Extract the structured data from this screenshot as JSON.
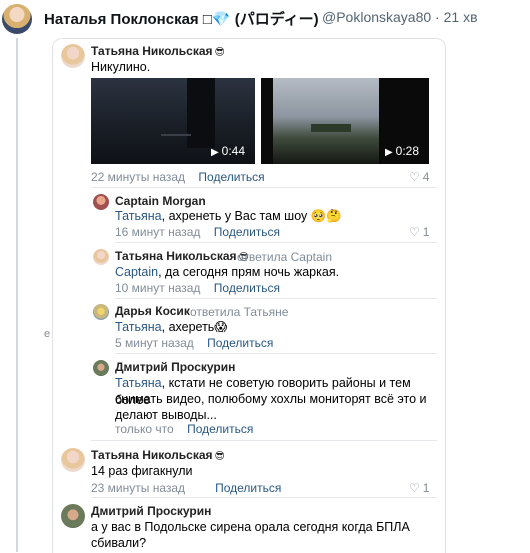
{
  "tweet": {
    "display_name": "Наталья Поклонская □💎 (パロディー)",
    "handle_time": "@Poklonskaya80 · 21 хв",
    "stray_char": "e"
  },
  "comments": [
    {
      "author": "Татьяна Никольская",
      "emoji": "😎",
      "text": "Никулино.",
      "videos": [
        {
          "duration": "0:44"
        },
        {
          "duration": "0:28"
        }
      ],
      "time": "22 минуты назад",
      "share": "Поделиться",
      "likes": "4"
    },
    {
      "author": "Captain Morgan",
      "mention": "Татьяна",
      "text": ", ахренеть у Вас там шоу 🥺🤔",
      "time": "16 минут назад",
      "share": "Поделиться",
      "likes": "1"
    },
    {
      "author": "Татьяна Никольская",
      "emoji": "😎",
      "reply_to": "ответила Captain",
      "mention": "Captain",
      "text": ", да сегодня прям ночь жаркая.",
      "time": "10 минут назад",
      "share": "Поделиться"
    },
    {
      "author": "Дарья Косик",
      "reply_to": "ответила Татьяне",
      "mention": "Татьяна",
      "text": ", ахереть😱",
      "time": "5 минут назад",
      "share": "Поделиться"
    },
    {
      "author": "Дмитрий Проскурин",
      "mention": "Татьяна",
      "text_line1": ", кстати не советую говорить районы и тем более",
      "text_line2": "снимать видео, полюбому хохлы мониторят всё это и",
      "text_line3": "делают выводы...",
      "time": "только что",
      "share": "Поделиться"
    },
    {
      "author": "Татьяна Никольская",
      "emoji": "😎",
      "text": "14 раз фигакнули",
      "time": "23 минуты назад",
      "share": "Поделиться",
      "likes": "1"
    },
    {
      "author": "Дмитрий Проскурин",
      "text_line1": "а у вас в Подольске сирена орала сегодня когда БПЛА",
      "text_line2": "сбивали?"
    }
  ],
  "icons": {
    "like": "heart-outline-icon",
    "play": "play-icon"
  }
}
